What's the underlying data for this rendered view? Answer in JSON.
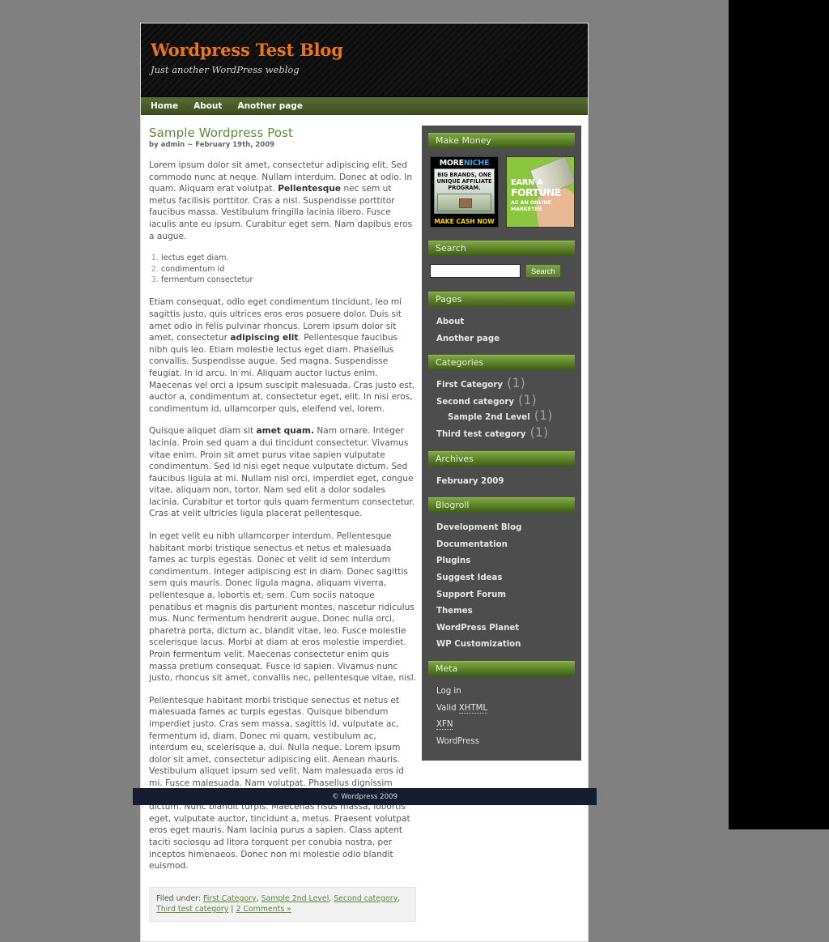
{
  "site": {
    "title": "Wordpress Test Blog",
    "description": "Just another WordPress weblog",
    "accent_green": "#5e8a3a",
    "title_orange": "#e8761a",
    "sidebar_bg": "#4d4d4d",
    "footer_bg": "#161d31"
  },
  "nav": {
    "items": [
      {
        "label": "Home"
      },
      {
        "label": "About"
      },
      {
        "label": "Another page"
      }
    ]
  },
  "post": {
    "title": "Sample Wordpress Post",
    "meta": "by admin ~ February 19th, 2009",
    "paragraph_1_a": "Lorem ipsum dolor sit amet, consectetur adipiscing elit. Sed commodo nunc at neque. Nullam interdum. Donec at odio. In quam. Aliquam erat volutpat. ",
    "paragraph_1_bold": "Pellentesque",
    "paragraph_1_b": " nec sem ut metus facilisis porttitor. Cras a nisl. Suspendisse porttitor faucibus massa. Vestibulum fringilla lacinia libero. Fusce iaculis ante eu ipsum. Curabitur eget sem. Nam dapibus eros a augue.",
    "list": [
      "lectus eget diam.",
      "condimentum id",
      "fermentum consectetur"
    ],
    "paragraph_2_a": "Etiam consequat, odio eget condimentum tincidunt, leo mi sagittis justo, quis ultrices eros eros posuere dolor. Duis sit amet odio in felis pulvinar rhoncus. Lorem ipsum dolor sit amet, consectetur ",
    "paragraph_2_bold": "adipiscing elit",
    "paragraph_2_b": ". Pellentesque faucibus nibh quis leo. Etiam molestie lectus eget diam. Phasellus convallis. Suspendisse augue. Sed magna. Suspendisse feugiat. In id arcu. In mi. Aliquam auctor luctus enim. Maecenas vel orci a ipsum suscipit malesuada. Cras justo est, auctor a, condimentum at, consectetur eget, elit. In nisi eros, condimentum id, ullamcorper quis, eleifend vel, lorem.",
    "paragraph_3_a": "Quisque aliquet diam sit ",
    "paragraph_3_bold": "amet quam.",
    "paragraph_3_b": " Nam ornare. Integer lacinia. Proin sed quam a dui tincidunt consectetur. Vivamus vitae enim. Proin sit amet purus vitae sapien vulputate condimentum. Sed id nisi eget neque vulputate dictum. Sed faucibus ligula at mi. Nullam nisl orci, imperdiet eget, congue vitae, aliquam non, tortor. Nam sed elit a dolor sodales lacinia. Curabitur et tortor quis quam fermentum consectetur. Cras at velit ultricies ligula placerat pellentesque.",
    "paragraph_4": "In eget velit eu nibh ullamcorper interdum. Pellentesque habitant morbi tristique senectus et netus et malesuada fames ac turpis egestas. Donec et velit id sem interdum condimentum. Integer adipiscing est in diam. Donec sagittis sem quis mauris. Donec ligula magna, aliquam viverra, pellentesque a, lobortis et, sem. Cum sociis natoque penatibus et magnis dis parturient montes, nascetur ridiculus mus. Nunc fermentum hendrerit augue. Donec nulla orci, pharetra porta, dictum ac, blandit vitae, leo. Fusce molestie scelerisque lacus. Morbi at diam at eros molestie imperdiet. Proin fermentum velit. Maecenas consectetur enim quis massa pretium consequat. Fusce id sapien. Vivamus nunc justo, rhoncus sit amet, convallis nec, pellentesque vitae, nisl.",
    "paragraph_5": "Pellentesque habitant morbi tristique senectus et netus et malesuada fames ac turpis egestas. Quisque bibendum imperdiet justo. Cras sem massa, sagittis id, vulputate ac, fermentum id, diam. Donec mi quam, vestibulum ac, interdum eu, scelerisque a, dui. Nulla neque. Lorem ipsum dolor sit amet, consectetur adipiscing elit. Aenean mauris. Vestibulum aliquet ipsum sed velit. Nam malesuada eros id mi. Fusce malesuada. Nam volutpat. Phasellus dignissim tristique sem. Maecenas dictum magna eget turpis. Nam dictum. Nunc blandit turpis. Maecenas risus massa, lobortis eget, vulputate auctor, tincidunt a, metus. Praesent volutpat eros eget mauris. Nam lacinia purus a sapien. Class aptent taciti sociosqu ad litora torquent per conubia nostra, per inceptos himenaeos. Donec non mi molestie odio blandit euismod.",
    "filed_label": "Filed under:",
    "filed_links": [
      "First Category",
      "Sample 2nd Level",
      "Second category",
      "Third test category"
    ],
    "comments_link": "2 Comments »"
  },
  "sidebar": {
    "make_money": {
      "title": "Make Money",
      "ads": [
        {
          "name": "moreniche-ad",
          "brand_part_1": "MORE",
          "brand_part_2": "NICHE",
          "headline": "BIG BRANDS, ONE UNIQUE AFFILIATE PROGRAM.",
          "cta": "MAKE CASH NOW"
        },
        {
          "name": "earn-a-fortune-ad",
          "line_1": "EARN A",
          "line_2": "FORTUNE",
          "line_3": "AS AN ONLINE MARKETER"
        }
      ]
    },
    "search": {
      "title": "Search",
      "value": "",
      "placeholder": "",
      "button_label": "Search"
    },
    "pages": {
      "title": "Pages",
      "items": [
        {
          "label": "About"
        },
        {
          "label": "Another page"
        }
      ]
    },
    "categories": {
      "title": "Categories",
      "items": [
        {
          "label": "First Category",
          "count": "(1)"
        },
        {
          "label": "Second category",
          "count": "(1)"
        },
        {
          "label": "Sample 2nd Level",
          "count": "(1)",
          "sub": true
        },
        {
          "label": "Third test category",
          "count": "(1)"
        }
      ]
    },
    "archives": {
      "title": "Archives",
      "items": [
        {
          "label": "February 2009"
        }
      ]
    },
    "blogroll": {
      "title": "Blogroll",
      "items": [
        {
          "label": "Development Blog"
        },
        {
          "label": "Documentation"
        },
        {
          "label": "Plugins"
        },
        {
          "label": "Suggest Ideas"
        },
        {
          "label": "Support Forum"
        },
        {
          "label": "Themes"
        },
        {
          "label": "WordPress Planet"
        },
        {
          "label": "WP Customization"
        }
      ]
    },
    "meta": {
      "title": "Meta",
      "items": [
        {
          "label": "Log in"
        },
        {
          "label": "Valid XHTML",
          "abbr": "XHTML"
        },
        {
          "label": "XFN",
          "abbr": "XFN"
        },
        {
          "label": "WordPress"
        }
      ]
    }
  },
  "footer": {
    "copyright": "© Wordpress 2009"
  }
}
